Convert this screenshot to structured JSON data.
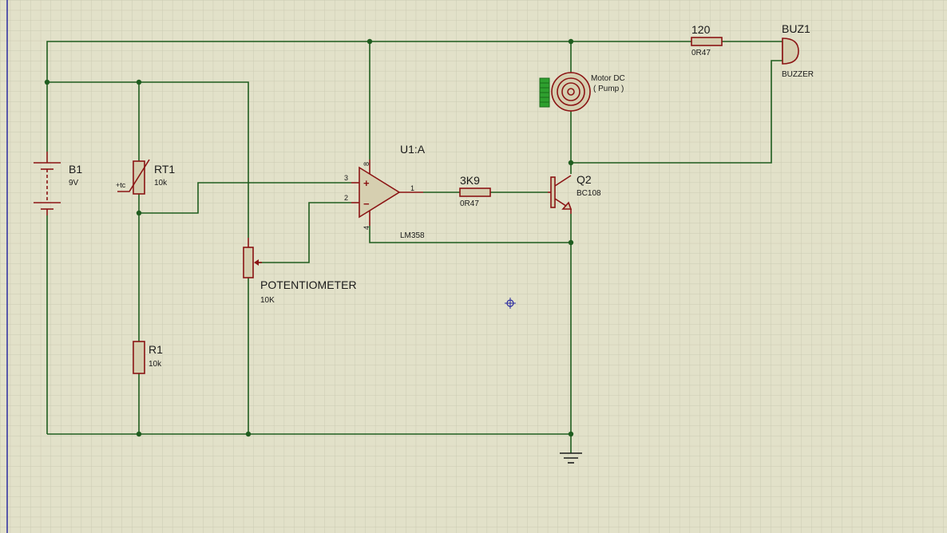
{
  "components": {
    "b1": {
      "ref": "B1",
      "value": "9V"
    },
    "rt1": {
      "ref": "RT1",
      "value": "10k",
      "marker": "+tc"
    },
    "r1": {
      "ref": "R1",
      "value": "10k"
    },
    "pot": {
      "ref": "POTENTIOMETER",
      "value": "10K"
    },
    "u1": {
      "ref": "U1:A",
      "value": "LM358",
      "pins": {
        "p8": "8",
        "p3": "3",
        "p2": "2",
        "p4": "4",
        "p1": "1"
      }
    },
    "r_base": {
      "ref": "3K9",
      "value": "0R47"
    },
    "q2": {
      "ref": "Q2",
      "value": "BC108"
    },
    "motor": {
      "name": "Motor DC",
      "sub": "( Pump )"
    },
    "r_buz": {
      "ref": "120",
      "value": "0R47"
    },
    "buz1": {
      "ref": "BUZ1",
      "value": "BUZZER"
    }
  },
  "colors": {
    "background": "#e2e1c9",
    "grid": "#cbcab2",
    "wire": "#1f5d1f",
    "component": "#8b1414",
    "component_fill": "#d6cfb0",
    "left_edge": "#2a2aa0",
    "cursor": "#2a2aa0"
  },
  "icons": {
    "cursor": "crosshair-cursor-icon",
    "ground": "ground-icon"
  }
}
